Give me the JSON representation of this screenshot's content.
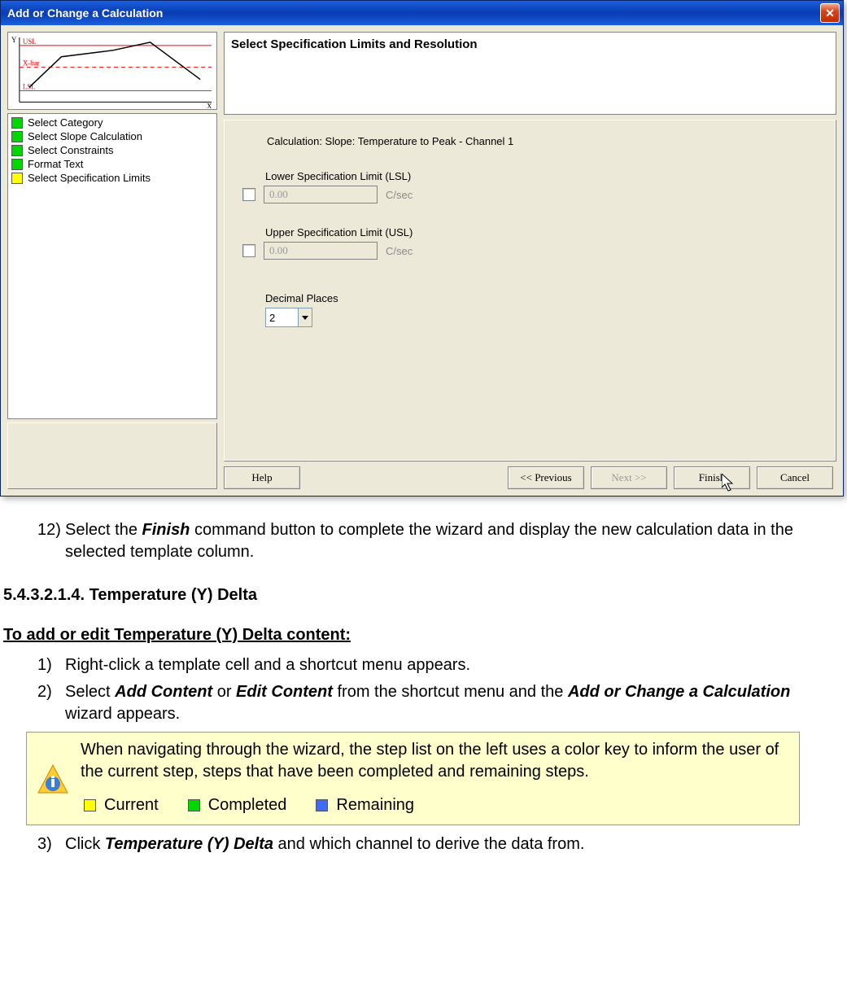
{
  "dialog": {
    "title": "Add or Change a Calculation",
    "heading": "Select Specification Limits and Resolution",
    "preview": {
      "y_label": "Y",
      "x_label": "X",
      "usl": "USL",
      "xbar": "X-bar",
      "lsl": "LSL"
    },
    "steps": [
      {
        "label": "Select Category",
        "state": "completed"
      },
      {
        "label": "Select Slope Calculation",
        "state": "completed"
      },
      {
        "label": "Select Constraints",
        "state": "completed"
      },
      {
        "label": "Format Text",
        "state": "completed"
      },
      {
        "label": "Select Specification Limits",
        "state": "current"
      }
    ],
    "form": {
      "calc_line": "Calculation: Slope: Temperature to Peak - Channel 1",
      "lsl_label": "Lower Specification Limit (LSL)",
      "lsl_value": "0.00",
      "usl_label": "Upper Specification Limit (USL)",
      "usl_value": "0.00",
      "unit": "C/sec",
      "decimals_label": "Decimal Places",
      "decimals_value": "2"
    },
    "buttons": {
      "help": "Help",
      "prev": "<< Previous",
      "next": "Next >>",
      "finish": "Finish",
      "cancel": "Cancel"
    }
  },
  "doc": {
    "item12": {
      "num": "12)",
      "pre": "Select the ",
      "bold": "Finish",
      "post": " command button to complete the wizard and display the new calculation data in the selected template column."
    },
    "h4": "5.4.3.2.1.4. Temperature (Y) Delta",
    "h5": "To add or edit Temperature (Y) Delta content:",
    "item1": {
      "num": "1)",
      "text": "Right-click a template cell and a shortcut menu appears."
    },
    "item2": {
      "num": "2)",
      "p1": "Select ",
      "b1": "Add Content",
      "p2": " or ",
      "b2": "Edit Content",
      "p3": " from the shortcut menu and the ",
      "b3": "Add or Change a Calculation",
      "p4": " wizard appears."
    },
    "note": {
      "text": "When navigating through the wizard, the step list on the left uses a color key to inform the user of the current step, steps that have been completed and remaining steps.",
      "legend": {
        "current": "Current",
        "completed": "Completed",
        "remaining": "Remaining"
      }
    },
    "item3": {
      "num": "3)",
      "p1": "Click ",
      "b1": "Temperature (Y) Delta",
      "p2": " and which channel to derive the data from."
    }
  }
}
